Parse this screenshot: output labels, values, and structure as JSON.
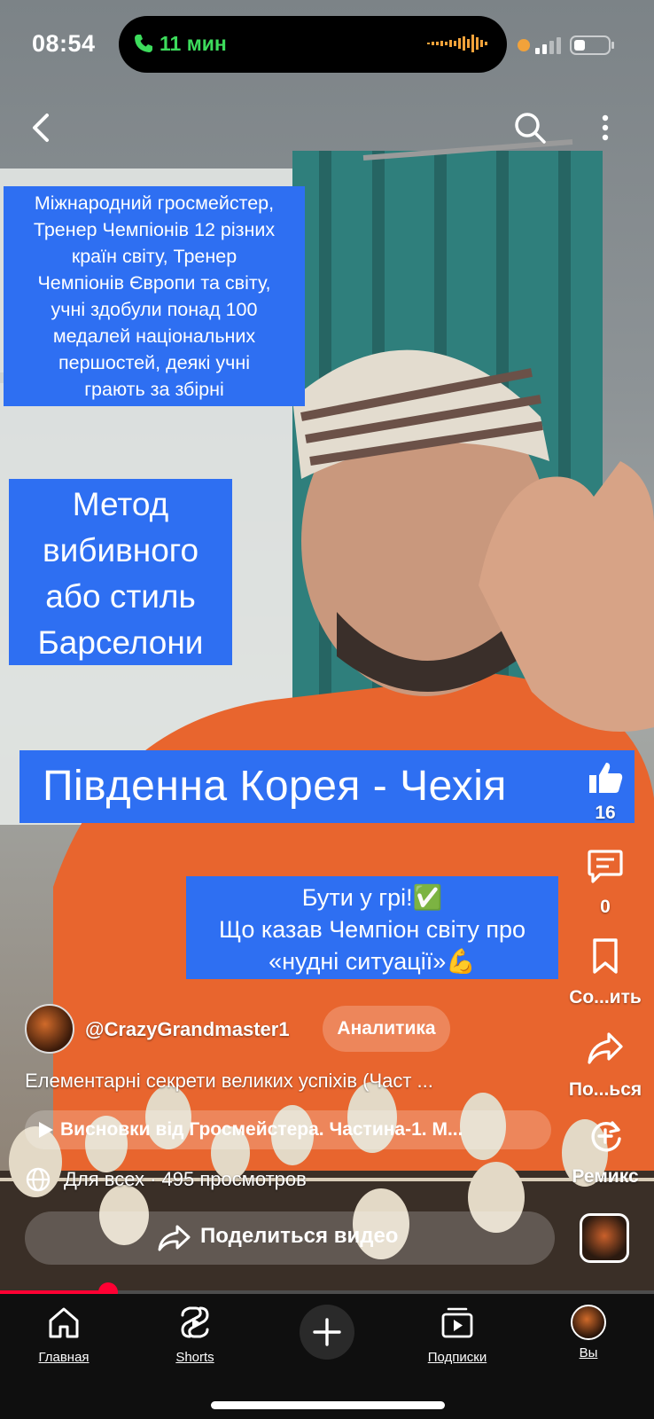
{
  "status_bar": {
    "time": "08:54",
    "call_duration": "11 мин"
  },
  "top_bar": {
    "back_icon": "chevron-left-icon",
    "search_icon": "search-icon",
    "more_icon": "more-vertical-icon"
  },
  "overlays": {
    "credentials_lines": [
      "Міжнародний гросмейстер,",
      "Тренер Чемпіонів 12 різних",
      "країн світу, Тренер",
      "Чемпіонів Європи та світу,",
      "учні здобули понад 100",
      "медалей національних",
      "першостей, деякі учні",
      "грають за  збірні"
    ],
    "method_lines": [
      "Метод",
      "вибивного",
      "або стиль",
      "Барселони"
    ],
    "match": "Південна Корея - Чехія",
    "quote_lines": [
      "Бути у грі!✅",
      "Що казав Чемпіон світу про",
      "«нудні ситуації»💪"
    ]
  },
  "actions": {
    "like_count": "16",
    "comment_count": "0",
    "save_label": "Со...ить",
    "share_label": "По...ься",
    "remix_label": "Ремикс"
  },
  "meta": {
    "channel": "@CrazyGrandmaster1",
    "analytics_label": "Аналитика",
    "title": "Елементарні секрети великих успіхів (Част ...",
    "playlist": "Висновки від Гросмейстера. Частина-1. М...",
    "views": "Для всех · 495 просмотров",
    "share_video": "Поделиться видео"
  },
  "progress": {
    "fraction": 0.165
  },
  "nav": {
    "home": "Главная",
    "shorts": "Shorts",
    "subscriptions": "Подписки",
    "you": "Вы"
  },
  "colors": {
    "caption_blue": "#2e6ff2",
    "progress_red": "#ff0033",
    "call_green": "#3ddc5c"
  }
}
